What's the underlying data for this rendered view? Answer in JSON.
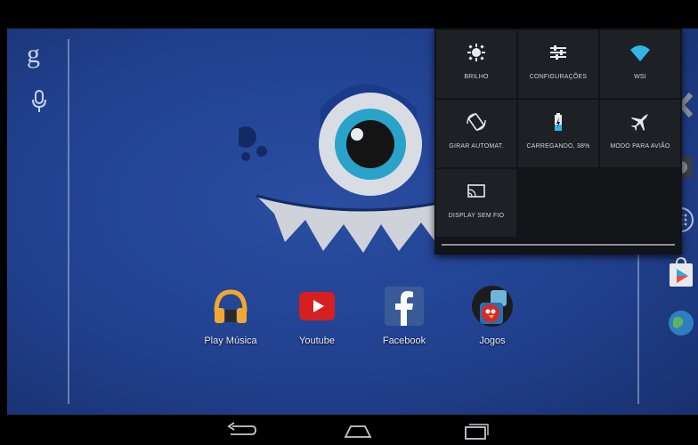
{
  "quick_settings": {
    "tiles": [
      {
        "label": "BRILHO",
        "icon": "brightness-icon"
      },
      {
        "label": "CONFIGURAÇÕES",
        "icon": "settings-sliders-icon"
      },
      {
        "label": "WSI",
        "icon": "wifi-icon"
      },
      {
        "label": "GIRAR AUTOMAT.",
        "icon": "auto-rotate-icon"
      },
      {
        "label": "CARREGANDO, 38%",
        "icon": "battery-icon"
      },
      {
        "label": "MODO PARA AVIÃO",
        "icon": "airplane-icon"
      },
      {
        "label": "DISPLAY SEM FIO",
        "icon": "wireless-display-icon"
      }
    ],
    "battery_level_percent": 38
  },
  "home": {
    "search_glyph": "g",
    "apps": [
      {
        "label": "Play Música",
        "icon": "headphones-icon"
      },
      {
        "label": "Youtube",
        "icon": "youtube-icon"
      },
      {
        "label": "Facebook",
        "icon": "facebook-icon"
      },
      {
        "label": "Jogos",
        "icon": "angry-birds-folder-icon"
      }
    ]
  },
  "colors": {
    "wallpaper": "#24479c",
    "panel": "#121417",
    "tile": "#1d2024",
    "accent_wifi": "#33b5e5"
  }
}
